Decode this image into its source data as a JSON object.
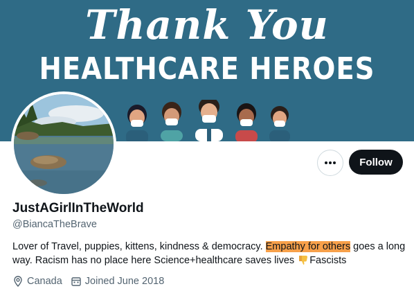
{
  "banner": {
    "line1": "Thank You",
    "line2": "HEALTHCARE HEROES"
  },
  "profile": {
    "display_name": "JustAGirlInTheWorld",
    "handle": "@BiancaTheBrave",
    "bio_part1": "Lover of Travel, puppies, kittens, kindness & democracy. ",
    "bio_highlight": "Empathy for others",
    "bio_part2": " goes a long way. Racism has no place here Science+healthcare saves lives ",
    "bio_part3": "Fascists",
    "location": "Canada",
    "joined": "Joined June 2018"
  },
  "actions": {
    "more_label": "•••",
    "follow_label": "Follow"
  },
  "colors": {
    "banner": "#2f6b86",
    "highlight": "#f7a04a",
    "follow_bg": "#0f1419",
    "secondary_text": "#536471"
  },
  "icons": {
    "more": "more-horizontal-icon",
    "bio_emoji": "thumbs-down-icon",
    "location": "map-pin-icon",
    "joined": "calendar-icon"
  }
}
